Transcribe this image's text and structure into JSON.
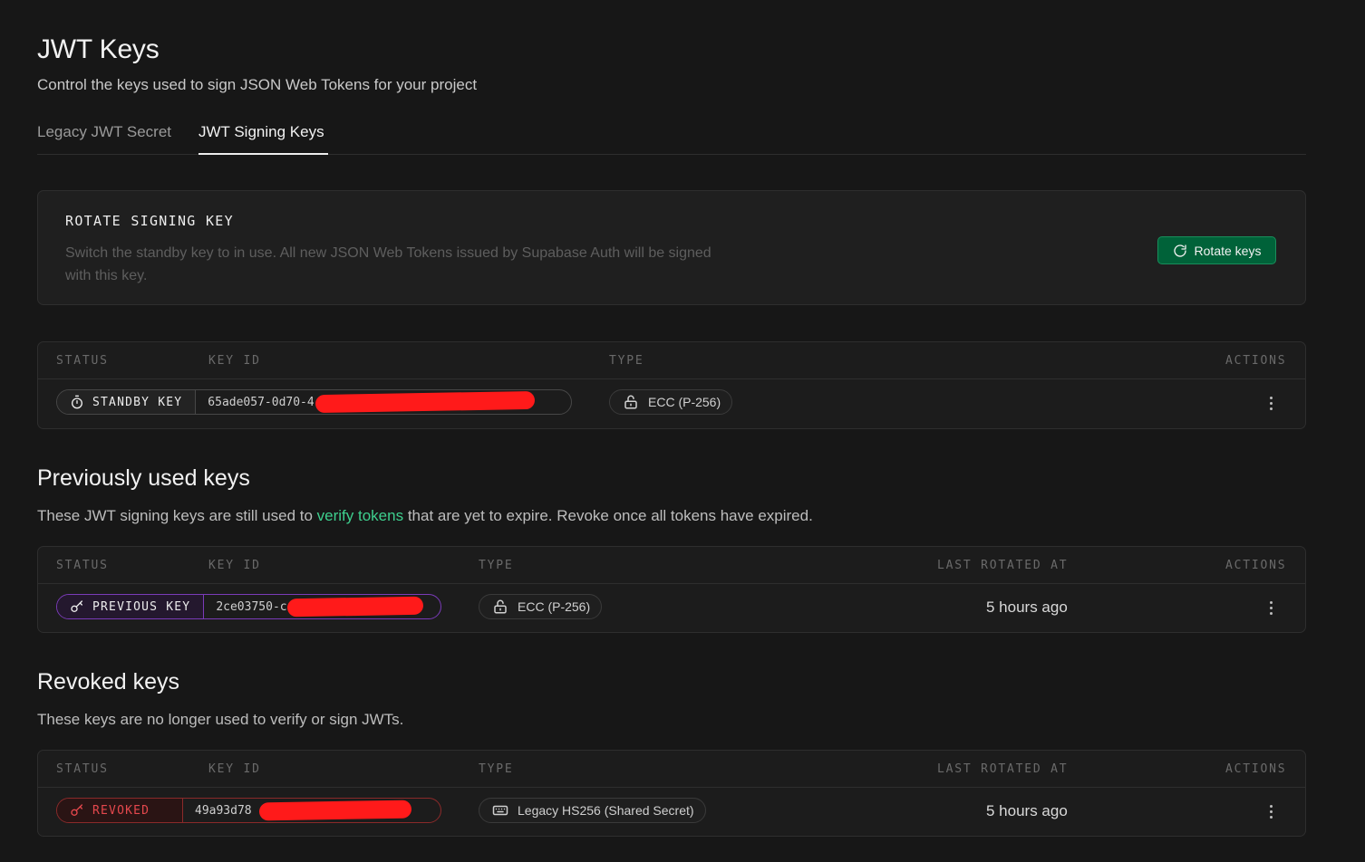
{
  "header": {
    "title": "JWT Keys",
    "subtitle": "Control the keys used to sign JSON Web Tokens for your project"
  },
  "tabs": [
    {
      "label": "Legacy JWT Secret",
      "active": false
    },
    {
      "label": "JWT Signing Keys",
      "active": true
    }
  ],
  "rotate": {
    "heading": "ROTATE SIGNING KEY",
    "description": "Switch the standby key to in use. All new JSON Web Tokens issued by Supabase Auth will be signed with this key.",
    "button_label": "Rotate keys",
    "button_icon": "refresh-icon"
  },
  "current_table": {
    "headers": {
      "status": "STATUS",
      "key_id": "KEY ID",
      "type": "TYPE",
      "actions": "ACTIONS"
    },
    "rows": [
      {
        "status": "STANDBY KEY",
        "status_icon": "timer-icon",
        "key_id": "65ade057-0d70-4",
        "type": "ECC (P-256)",
        "type_icon": "lock-open-icon"
      }
    ]
  },
  "previous": {
    "title": "Previously used keys",
    "desc_before": "These JWT signing keys are still used to ",
    "desc_link": "verify tokens",
    "desc_after": " that are yet to expire. Revoke once all tokens have expired.",
    "table": {
      "headers": {
        "status": "STATUS",
        "key_id": "KEY ID",
        "type": "TYPE",
        "last_rotated": "LAST ROTATED AT",
        "actions": "ACTIONS"
      },
      "rows": [
        {
          "status": "PREVIOUS KEY",
          "status_icon": "key-icon",
          "key_id": "2ce03750-c",
          "type": "ECC (P-256)",
          "type_icon": "lock-open-icon",
          "last_rotated": "5 hours ago"
        }
      ]
    }
  },
  "revoked": {
    "title": "Revoked keys",
    "description": "These keys are no longer used to verify or sign JWTs.",
    "table": {
      "headers": {
        "status": "STATUS",
        "key_id": "KEY ID",
        "type": "TYPE",
        "last_rotated": "LAST ROTATED AT",
        "actions": "ACTIONS"
      },
      "rows": [
        {
          "status": "REVOKED",
          "status_icon": "key-icon",
          "key_id": "49a93d78",
          "type": "Legacy HS256 (Shared Secret)",
          "type_icon": "keyboard-icon",
          "last_rotated": "5 hours ago"
        }
      ]
    }
  },
  "colors": {
    "background": "#171717",
    "accent_green": "#3ecf8e",
    "button_green": "#006239",
    "previous_purple": "#8e44d6",
    "revoked_red": "#e5484d",
    "redaction": "#ff1a1a"
  }
}
